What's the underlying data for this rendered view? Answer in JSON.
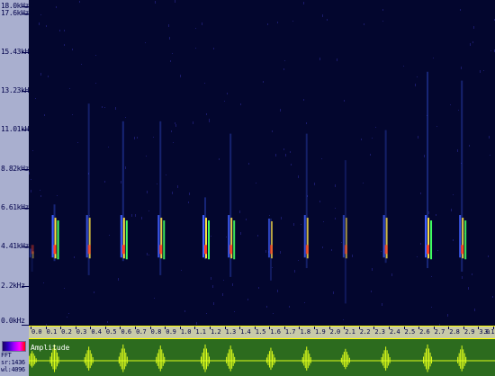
{
  "freq_axis": {
    "labels": [
      "18.0kHz",
      "17.6kHz",
      "15.43kHz",
      "13.23kHz",
      "11.01kHz",
      "8.82kHz",
      "6.61kHz",
      "4.41kHz",
      "2.2kHz",
      "0.0kHz"
    ]
  },
  "time_axis": {
    "labels": [
      "0.0",
      "0.1",
      "0.2",
      "0.3",
      "0.4",
      "0.5",
      "0.6",
      "0.7",
      "0.8",
      "0.9",
      "1.0",
      "1.1",
      "1.2",
      "1.3",
      "1.4",
      "1.5",
      "1.6",
      "1.7",
      "1.8",
      "1.9",
      "2.0",
      "2.1",
      "2.2",
      "2.3",
      "2.4",
      "2.5",
      "2.6",
      "2.7",
      "2.8",
      "2.9",
      "3.0",
      "3.1"
    ]
  },
  "amplitude": {
    "label": "Amplitude"
  },
  "fft_info": {
    "title": "FFT",
    "line1": "sr:1436",
    "line2": "wl:4096"
  },
  "colors": {
    "background": "#03062e",
    "panel": "#a9afcf",
    "waveform_bg": "#2c6b1e",
    "waveform_trace": "#e0ff1a",
    "hot": "#ff4020",
    "mid": "#ffe040",
    "cool": "#4060ff"
  },
  "chart_data": {
    "type": "heatmap",
    "xlabel": "",
    "ylabel": "",
    "x_unit": "s",
    "y_unit": "kHz",
    "xlim": [
      0.0,
      3.1
    ],
    "ylim": [
      0.0,
      18.0
    ],
    "y_ticks": [
      0.0,
      2.2,
      4.41,
      6.61,
      8.82,
      11.01,
      13.23,
      15.43,
      17.6,
      18.0
    ],
    "x_ticks": [
      0.0,
      0.1,
      0.2,
      0.3,
      0.4,
      0.5,
      0.6,
      0.7,
      0.8,
      0.9,
      1.0,
      1.1,
      1.2,
      1.3,
      1.4,
      1.5,
      1.6,
      1.7,
      1.8,
      1.9,
      2.0,
      2.1,
      2.2,
      2.3,
      2.4,
      2.5,
      2.6,
      2.7,
      2.8,
      2.9,
      3.0,
      3.1
    ],
    "calls": [
      {
        "t": 0.01,
        "f_low": 3.0,
        "f_high": 4.3,
        "intensity": 0.4
      },
      {
        "t": 0.16,
        "f_low": 3.6,
        "f_high": 6.8,
        "intensity": 1.0
      },
      {
        "t": 0.39,
        "f_low": 2.8,
        "f_high": 12.5,
        "intensity": 0.8
      },
      {
        "t": 0.62,
        "f_low": 3.6,
        "f_high": 11.5,
        "intensity": 1.0
      },
      {
        "t": 0.87,
        "f_low": 2.8,
        "f_high": 11.5,
        "intensity": 0.9
      },
      {
        "t": 1.17,
        "f_low": 3.7,
        "f_high": 7.2,
        "intensity": 1.0
      },
      {
        "t": 1.34,
        "f_low": 2.7,
        "f_high": 10.8,
        "intensity": 0.9
      },
      {
        "t": 1.61,
        "f_low": 2.5,
        "f_high": 6.0,
        "intensity": 0.7
      },
      {
        "t": 1.85,
        "f_low": 3.2,
        "f_high": 10.8,
        "intensity": 0.8
      },
      {
        "t": 2.11,
        "f_low": 1.2,
        "f_high": 9.3,
        "intensity": 0.6
      },
      {
        "t": 2.38,
        "f_low": 3.5,
        "f_high": 11.0,
        "intensity": 0.8
      },
      {
        "t": 2.66,
        "f_low": 3.2,
        "f_high": 14.3,
        "intensity": 1.0
      },
      {
        "t": 2.89,
        "f_low": 3.0,
        "f_high": 13.8,
        "intensity": 0.9
      }
    ]
  }
}
